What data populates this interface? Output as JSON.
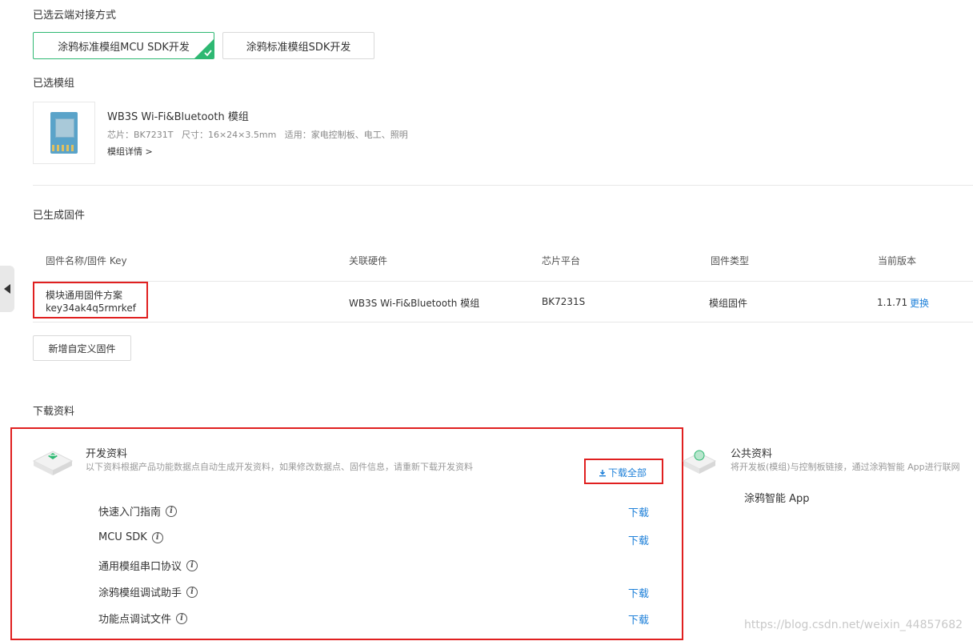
{
  "cloud_mode": {
    "title": "已选云端对接方式",
    "options": [
      {
        "label": "涂鸦标准模组MCU SDK开发",
        "selected": true
      },
      {
        "label": "涂鸦标准模组SDK开发",
        "selected": false
      }
    ]
  },
  "module": {
    "title": "已选模组",
    "name": "WB3S Wi-Fi&Bluetooth 模组",
    "specs": "芯片：BK7231T   尺寸：16×24×3.5mm   适用：家电控制板、电工、照明",
    "detail_link": "模组详情 >"
  },
  "firmware": {
    "title": "已生成固件",
    "columns": [
      "固件名称/固件 Key",
      "关联硬件",
      "芯片平台",
      "固件类型",
      "当前版本"
    ],
    "rows": [
      {
        "name": "模块通用固件方案",
        "key": "key34ak4q5rmrkef",
        "hardware": "WB3S Wi-Fi&Bluetooth 模组",
        "chip": "BK7231S",
        "type": "模组固件",
        "version": "1.1.71",
        "change_link": "更换"
      }
    ],
    "add_button": "新增自定义固件"
  },
  "downloads": {
    "title": "下载资料",
    "dev": {
      "title": "开发资料",
      "desc": "以下资料根据产品功能数据点自动生成开发资料，如果修改数据点、固件信息，请重新下载开发资料",
      "download_all": "下载全部",
      "items": [
        {
          "label": "快速入门指南",
          "action": "下载"
        },
        {
          "label": "MCU SDK",
          "action": "下载"
        },
        {
          "label": "通用模组串口协议",
          "action": ""
        },
        {
          "label": "涂鸦模组调试助手",
          "action": "下载"
        },
        {
          "label": "功能点调试文件",
          "action": "下载"
        }
      ]
    },
    "public": {
      "title": "公共资料",
      "desc": "将开发板(模组)与控制板链接，通过涂鸦智能 App进行联网",
      "items": [
        {
          "label": "涂鸦智能 App"
        }
      ]
    }
  },
  "watermark": "https://blog.csdn.net/weixin_44857682",
  "colors": {
    "accent": "#2eb872",
    "link": "#1e80d9",
    "highlight": "#e02020"
  }
}
